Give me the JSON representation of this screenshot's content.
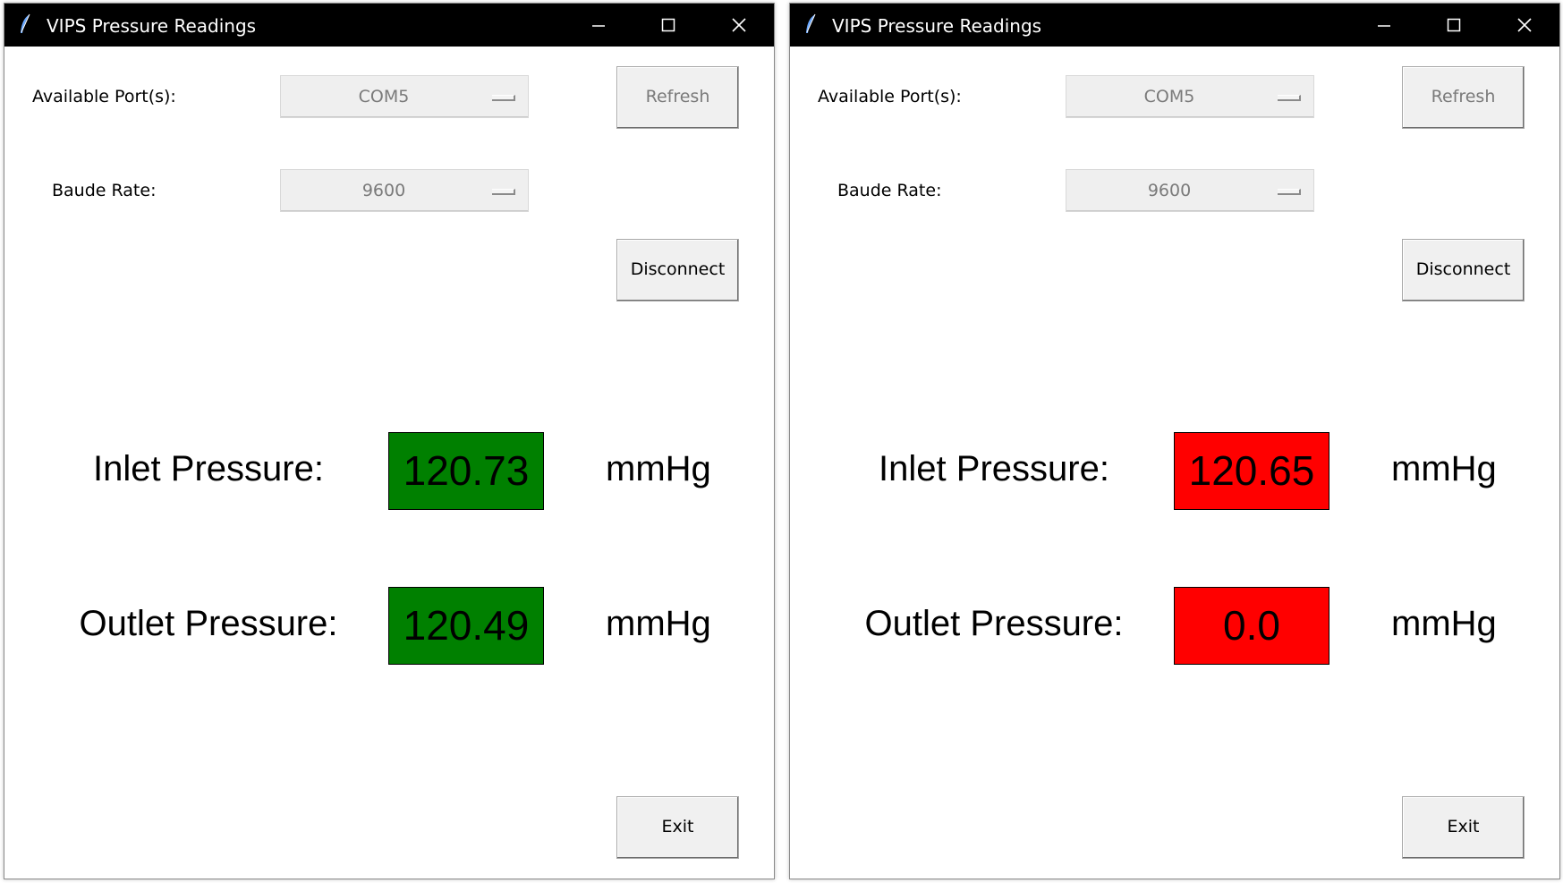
{
  "windows": [
    {
      "title": "VIPS Pressure Readings",
      "port_label": "Available Port(s):",
      "port_value": "COM5",
      "baud_label": "Baude Rate:",
      "baud_value": "9600",
      "refresh_label": "Refresh",
      "disconnect_label": "Disconnect",
      "inlet_label": "Inlet Pressure:",
      "inlet_value": "120.73",
      "inlet_unit": "mmHg",
      "outlet_label": "Outlet Pressure:",
      "outlet_value": "120.49",
      "outlet_unit": "mmHg",
      "status_color": "#008000",
      "exit_label": "Exit"
    },
    {
      "title": "VIPS Pressure Readings",
      "port_label": "Available Port(s):",
      "port_value": "COM5",
      "baud_label": "Baude Rate:",
      "baud_value": "9600",
      "refresh_label": "Refresh",
      "disconnect_label": "Disconnect",
      "inlet_label": "Inlet Pressure:",
      "inlet_value": "120.65",
      "inlet_unit": "mmHg",
      "outlet_label": "Outlet Pressure:",
      "outlet_value": "0.0",
      "outlet_unit": "mmHg",
      "status_color": "#ff0000",
      "exit_label": "Exit"
    }
  ],
  "icons": {
    "app": "feather-icon",
    "minimize": "minimize-icon",
    "maximize": "maximize-icon",
    "close": "close-icon",
    "dropdown": "dropdown-arrow-icon"
  }
}
